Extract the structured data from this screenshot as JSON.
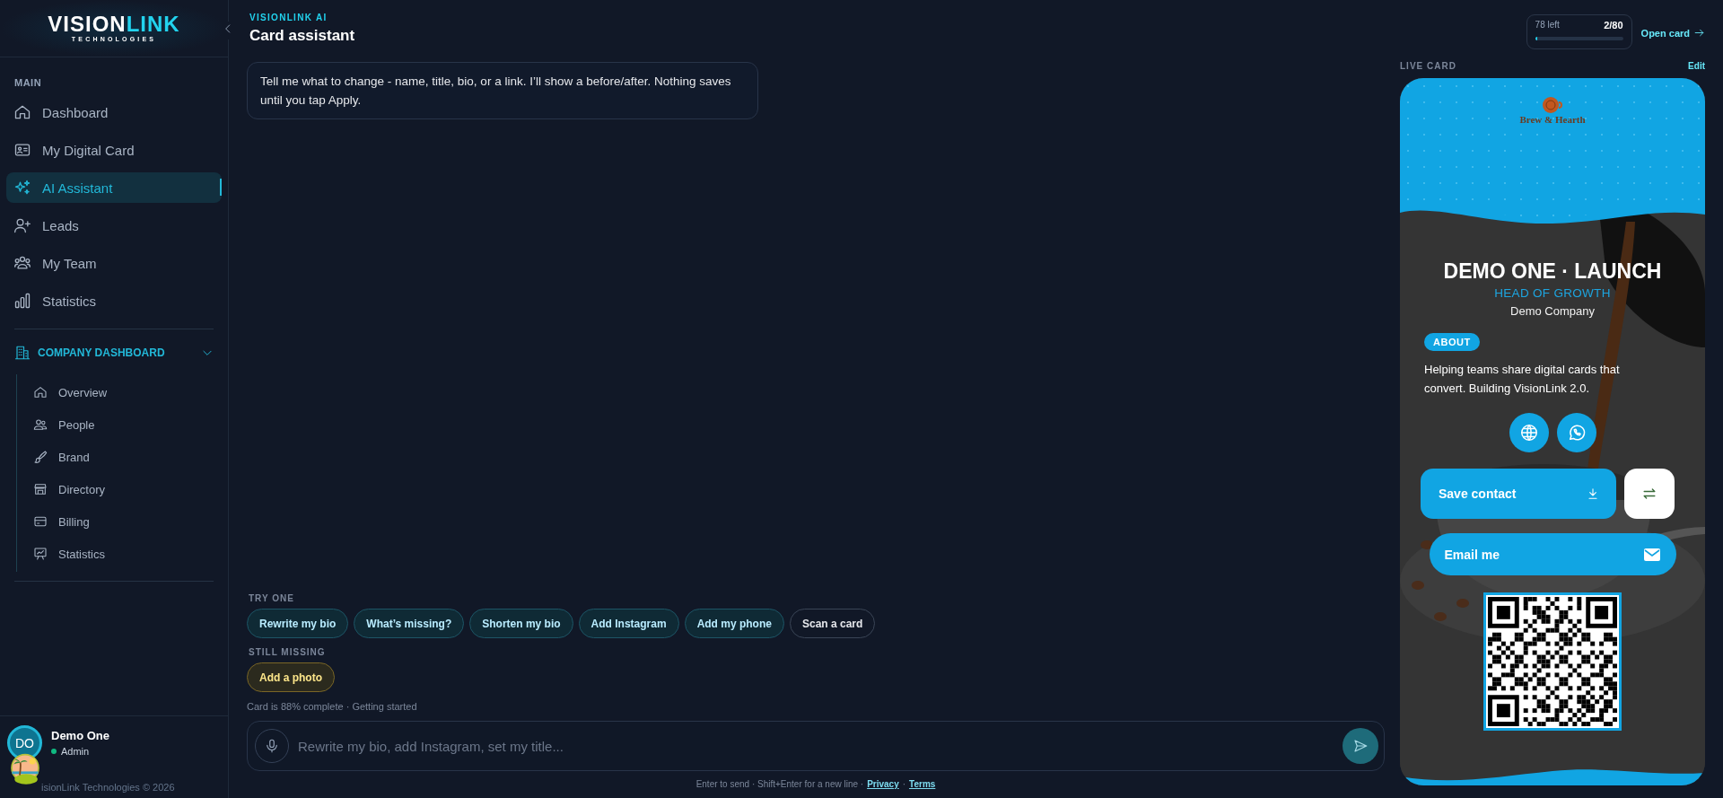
{
  "sidebar": {
    "logo": {
      "primary": "VISION",
      "accent": "LINK",
      "tagline": "TECHNOLOGIES"
    },
    "main_section": {
      "title": "MAIN",
      "items": [
        {
          "label": "Dashboard",
          "selected": false
        },
        {
          "label": "My Digital Card",
          "selected": false
        },
        {
          "label": "AI Assistant",
          "selected": true
        },
        {
          "label": "Leads",
          "selected": false
        },
        {
          "label": "My Team",
          "selected": false
        },
        {
          "label": "Statistics",
          "selected": false
        }
      ]
    },
    "company_section": {
      "title": "COMPANY DASHBOARD",
      "expanded": true,
      "items": [
        {
          "label": "Overview"
        },
        {
          "label": "People"
        },
        {
          "label": "Brand"
        },
        {
          "label": "Directory"
        },
        {
          "label": "Billing"
        },
        {
          "label": "Statistics"
        }
      ]
    },
    "user": {
      "initials": "DO",
      "name": "Demo One",
      "role": "Admin",
      "online": true
    },
    "footer": "isionLink Technologies © 2026"
  },
  "header": {
    "eyebrow": "VISIONLINK AI",
    "title": "Card assistant"
  },
  "messages": [
    {
      "text": "Tell me what to change - name, title, bio, or a link. I’ll show a before/after. Nothing saves until you tap Apply."
    }
  ],
  "suggestions": {
    "title": "TRY ONE",
    "chips": [
      {
        "label": "Rewrite my bio",
        "kind": "prompt"
      },
      {
        "label": "What’s missing?",
        "kind": "prompt"
      },
      {
        "label": "Shorten my bio",
        "kind": "prompt"
      },
      {
        "label": "Add Instagram",
        "kind": "prompt"
      },
      {
        "label": "Add my phone",
        "kind": "prompt"
      },
      {
        "label": "Scan a card",
        "kind": "action"
      }
    ]
  },
  "missing": {
    "title": "STILL MISSING",
    "chips": [
      {
        "label": "Add a photo",
        "kind": "missing"
      }
    ]
  },
  "progress_note": "Card is 88% complete · Getting started",
  "composer": {
    "placeholder": "Rewrite my bio, add Instagram, set my title..."
  },
  "hint": {
    "text": "Enter to send · Shift+Enter for a new line ·",
    "links": [
      "Privacy",
      "Terms"
    ],
    "separator": "·"
  },
  "usage": {
    "remaining": "78 left",
    "count": "2/80",
    "level": 0.025
  },
  "open_card": "Open card",
  "live_card": {
    "label": "LIVE CARD",
    "edit": "Edit",
    "brand": "Brew & Hearth",
    "name": "DEMO ONE · LAUNCH",
    "title": "HEAD OF GROWTH",
    "company": "Demo Company",
    "about_label": "ABOUT",
    "bio": "Helping teams share digital cards that convert. Building VisionLink 2.0.",
    "save_label": "Save contact",
    "email_label": "Email me"
  }
}
